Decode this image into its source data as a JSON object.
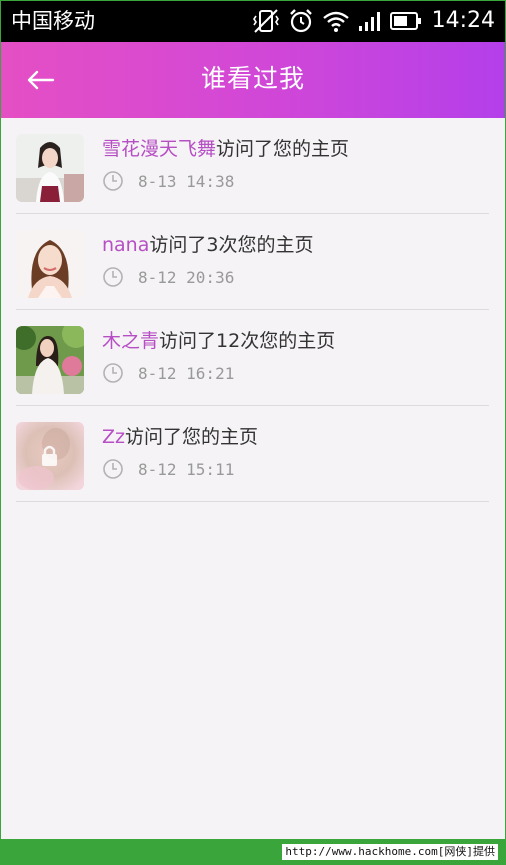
{
  "status_bar": {
    "carrier": "中国移动",
    "time": "14:24"
  },
  "header": {
    "title": "谁看过我",
    "back_label": "←"
  },
  "visits": [
    {
      "name": "雪花漫天飞舞",
      "action": "访问了您的主页",
      "time": "8-13  14:38",
      "avatar": "photo-girl-white-dress"
    },
    {
      "name": "nana",
      "action": "访问了3次您的主页",
      "time": "8-12  20:36",
      "avatar": "photo-girl-smiling"
    },
    {
      "name": "木之青",
      "action": "访问了12次您的主页",
      "time": "8-12  16:21",
      "avatar": "photo-girl-outdoors"
    },
    {
      "name": "Zz",
      "action": "访问了您的主页",
      "time": "8-12  15:11",
      "avatar": "blurred-locked-photo"
    }
  ],
  "footer": {
    "credit": "http://www.hackhome.com[网侠]提供"
  }
}
